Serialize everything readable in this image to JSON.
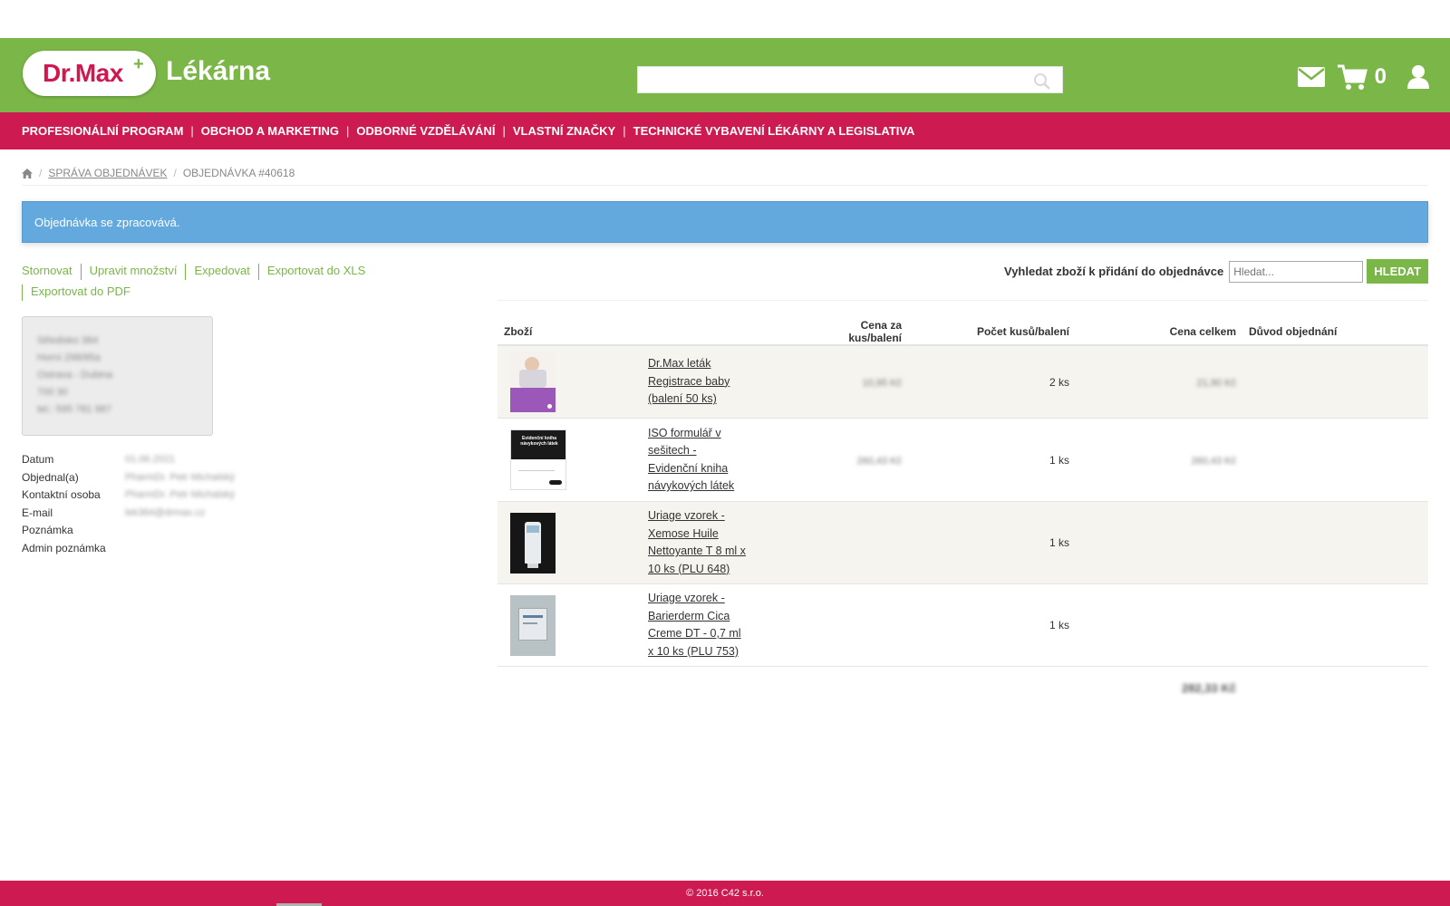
{
  "header": {
    "logo_text": "Dr.Max",
    "logo_plus": "+",
    "brand_sub": "Lékárna",
    "search_placeholder": "",
    "cart_count": "0"
  },
  "nav": {
    "items": [
      "PROFESIONÁLNÍ PROGRAM",
      "OBCHOD A MARKETING",
      "ODBORNÉ VZDĚLÁVÁNÍ",
      "VLASTNÍ ZNAČKY",
      "TECHNICKÉ VYBAVENÍ LÉKÁRNY A LEGISLATIVA"
    ]
  },
  "breadcrumb": {
    "manage": "SPRÁVA OBJEDNÁVEK",
    "current": "OBJEDNÁVKA #40618"
  },
  "alert": "Objednávka se zpracovává.",
  "actions": {
    "cancel": "Stornovat",
    "edit_qty": "Upravit množství",
    "dispatch": "Expedovat",
    "export_xls": "Exportovat do XLS",
    "export_pdf": "Exportovat do PDF"
  },
  "add_search": {
    "label": "Vyhledat zboží k přidání do objednávce",
    "placeholder": "Hledat...",
    "button": "HLEDAT"
  },
  "address": {
    "lines": [
      "Středisko 384",
      "Horní 298/85a",
      "Ostrava - Dubina",
      "700 30",
      "tel.: 595 781 987"
    ]
  },
  "info": {
    "date_label": "Datum",
    "date_value": "01.06.2021",
    "ordered_label": "Objednal(a)",
    "ordered_value": "PharmDr. Petr Michalský",
    "contact_label": "Kontaktní osoba",
    "contact_value": "PharmDr. Petr Michalský",
    "email_label": "E-mail",
    "email_value": "lek384@drmax.cz",
    "note_label": "Poznámka",
    "admin_note_label": "Admin poznámka"
  },
  "table": {
    "headers": {
      "product": "Zboží",
      "unit_price": "Cena za kus/balení",
      "qty": "Počet kusů/balení",
      "total": "Cena celkem",
      "reason": "Důvod objednání"
    },
    "rows": [
      {
        "name": "Dr.Max leták Registrace baby (balení 50 ks)",
        "price": "10,95 Kč",
        "qty": "2 ks",
        "total": "21,90 Kč"
      },
      {
        "name": "ISO formulář v sešitech - Evidenční kniha návykových látek",
        "price": "260,43 Kč",
        "qty": "1 ks",
        "total": "260,43 Kč"
      },
      {
        "name": "Uriage vzorek - Xemose Huile Nettoyante T 8 ml x 10 ks (PLU 648)",
        "price": "",
        "qty": "1 ks",
        "total": ""
      },
      {
        "name": "Uriage vzorek - Barierderm Cica Creme DT - 0,7 ml x 10 ks (PLU 753)",
        "price": "",
        "qty": "1 ks",
        "total": ""
      }
    ],
    "grand_total": "282,33 Kč"
  },
  "thumb_text": {
    "iso_title": "Evidenční kniha návykových látek"
  },
  "footer": "© 2016 C42 s.r.o."
}
